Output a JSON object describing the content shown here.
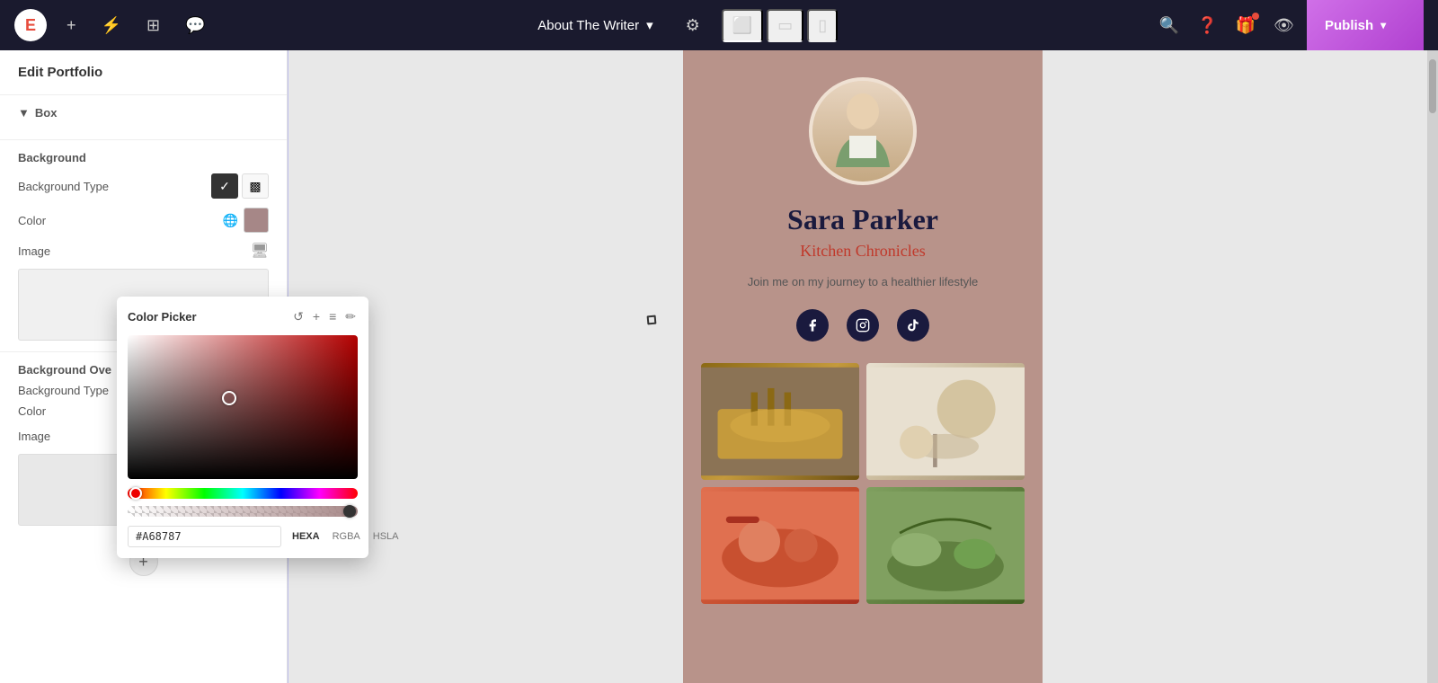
{
  "topbar": {
    "logo_letter": "E",
    "page_title": "About The Writer",
    "publish_label": "Publish",
    "devices": [
      "desktop",
      "tablet",
      "mobile"
    ]
  },
  "leftpanel": {
    "title": "Edit Portfolio",
    "box_section": "Box",
    "background_label": "Background",
    "background_type_label": "Background Type",
    "color_label": "Color",
    "image_label": "Image",
    "bg_overlay_label": "Background Ove",
    "bg_overlay_type_label": "Background Type",
    "color_value": "#a68787",
    "color_overlay_label": "Color",
    "image_overlay_label": "Image"
  },
  "colorpicker": {
    "title": "Color Picker",
    "hex_value": "#A68787",
    "format_hexa": "HEXA",
    "format_rgba": "RGBA",
    "format_hsla": "HSLA"
  },
  "preview": {
    "name": "Sara Parker",
    "tagline": "Kitchen Chronicles",
    "bio": "Join me on my journey to a healthier lifestyle",
    "background_color": "#b8938a"
  }
}
